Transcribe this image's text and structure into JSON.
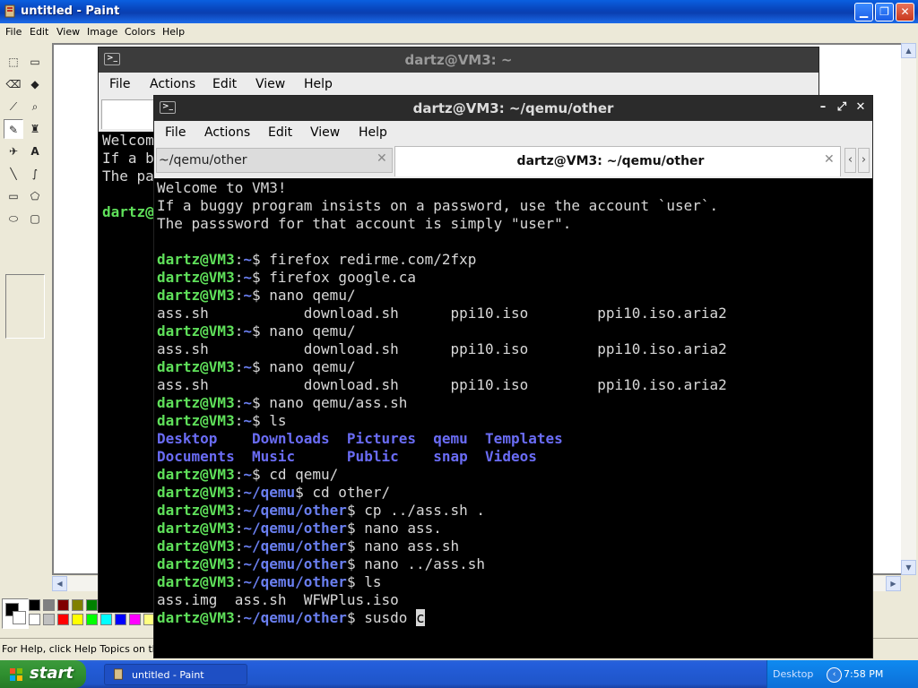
{
  "paint": {
    "title": "untitled - Paint",
    "menu": [
      "File",
      "Edit",
      "View",
      "Image",
      "Colors",
      "Help"
    ],
    "status": "For Help, click Help Topics on the He",
    "palette_row1": [
      "#000000",
      "#808080",
      "#800000",
      "#808000",
      "#008000",
      "#008080",
      "#000080",
      "#800080",
      "#808040",
      "#004040"
    ],
    "palette_row2": [
      "#ffffff",
      "#c0c0c0",
      "#ff0000",
      "#ffff00",
      "#00ff00",
      "#00ffff",
      "#0000ff",
      "#ff00ff",
      "#ffff80",
      "#00ff80"
    ]
  },
  "taskbar": {
    "start_label": "start",
    "task_button": "untitled - Paint",
    "desktop_label": "Desktop",
    "clock": "7:58 PM"
  },
  "term_back": {
    "title": "dartz@VM3: ~",
    "menu": [
      "File",
      "Actions",
      "Edit",
      "View",
      "Help"
    ],
    "lines": [
      "Welcom",
      "If a b",
      "The pa",
      "",
      "dartz@"
    ]
  },
  "term_front": {
    "title": "dartz@VM3: ~/qemu/other",
    "menu": [
      "File",
      "Actions",
      "Edit",
      "View",
      "Help"
    ],
    "tabs": [
      {
        "label": "~/qemu/other",
        "active": false
      },
      {
        "label": "dartz@VM3: ~/qemu/other",
        "active": true
      }
    ],
    "prompt_user": "dartz@VM3",
    "lines": [
      {
        "kind": "text",
        "text": "Welcome to VM3!"
      },
      {
        "kind": "text",
        "text": "If a buggy program insists on a password, use the account `user`."
      },
      {
        "kind": "text",
        "text": "The passsword for that account is simply \"user\"."
      },
      {
        "kind": "text",
        "text": ""
      },
      {
        "kind": "prompt",
        "path": "~",
        "cmd": "firefox redirme.com/2fxp"
      },
      {
        "kind": "prompt",
        "path": "~",
        "cmd": "firefox google.ca"
      },
      {
        "kind": "prompt",
        "path": "~",
        "cmd": "nano qemu/"
      },
      {
        "kind": "text",
        "text": "ass.sh           download.sh      ppi10.iso        ppi10.iso.aria2"
      },
      {
        "kind": "prompt",
        "path": "~",
        "cmd": "nano qemu/"
      },
      {
        "kind": "text",
        "text": "ass.sh           download.sh      ppi10.iso        ppi10.iso.aria2"
      },
      {
        "kind": "prompt",
        "path": "~",
        "cmd": "nano qemu/"
      },
      {
        "kind": "text",
        "text": "ass.sh           download.sh      ppi10.iso        ppi10.iso.aria2"
      },
      {
        "kind": "prompt",
        "path": "~",
        "cmd": "nano qemu/ass.sh"
      },
      {
        "kind": "prompt",
        "path": "~",
        "cmd": "ls"
      },
      {
        "kind": "dirs",
        "text": "Desktop    Downloads  Pictures  qemu  Templates"
      },
      {
        "kind": "dirs",
        "text": "Documents  Music      Public    snap  Videos"
      },
      {
        "kind": "prompt",
        "path": "~",
        "cmd": "cd qemu/"
      },
      {
        "kind": "prompt",
        "path": "~/qemu",
        "cmd": "cd other/"
      },
      {
        "kind": "prompt",
        "path": "~/qemu/other",
        "cmd": "cp ../ass.sh ."
      },
      {
        "kind": "prompt",
        "path": "~/qemu/other",
        "cmd": "nano ass."
      },
      {
        "kind": "prompt",
        "path": "~/qemu/other",
        "cmd": "nano ass.sh"
      },
      {
        "kind": "prompt",
        "path": "~/qemu/other",
        "cmd": "nano ../ass.sh"
      },
      {
        "kind": "prompt",
        "path": "~/qemu/other",
        "cmd": "ls"
      },
      {
        "kind": "text",
        "text": "ass.img  ass.sh  WFWPlus.iso"
      },
      {
        "kind": "prompt",
        "path": "~/qemu/other",
        "cmd": "susdo c",
        "cursor": true
      }
    ]
  }
}
